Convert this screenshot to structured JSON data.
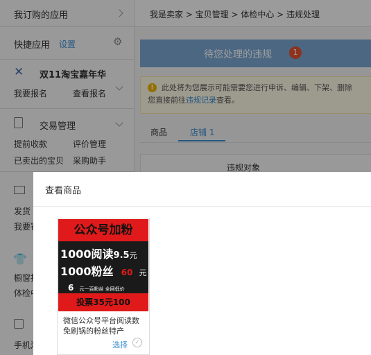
{
  "sidebar": {
    "subscribed_apps": "我订购的应用",
    "quick_apps": "快捷应用",
    "quick_settings": "设置",
    "promo_title": "双11淘宝嘉年华",
    "promo_links": [
      "我要报名",
      "查看报名"
    ],
    "trade_title": "交易管理",
    "trade_links": [
      "提前收款",
      "评价管理",
      "已卖出的宝贝",
      "采购助手"
    ],
    "partial_a": [
      "发货",
      "我要寄"
    ],
    "partial_b": [
      "橱窗推",
      "体检中"
    ],
    "partial_c": "手机淘"
  },
  "breadcrumb": "我是卖家 > 宝贝管理 > 体检中心 > 违规处理",
  "banner": {
    "label": "待您处理的违规",
    "count": "1"
  },
  "tip": {
    "line1": "此处将为您展示可能需要您进行申诉、编辑、下架、删除",
    "line2_prefix": "您直接前往",
    "line2_link": "违规记录",
    "line2_suffix": "查看。"
  },
  "tabs": [
    {
      "label": "商品"
    },
    {
      "label": "店铺 1"
    }
  ],
  "table": {
    "column": "违规对象"
  },
  "modal": {
    "title": "查看商品",
    "product": {
      "ad": {
        "headline": "公众号加粉",
        "line1_main": "1000阅读",
        "line1_price": "9.5",
        "line1_unit": "元",
        "line2_main": "1000粉丝",
        "line2_price": "60",
        "line2_unit": "元",
        "line3_num": "6",
        "line3_text": "元一百粉丝 全网低价",
        "bottom": "投票35元100"
      },
      "title": "微信公众号平台阅读数免刷锅的粉丝特产",
      "select_label": "选择"
    }
  },
  "colors": {
    "accent_blue": "#3d8fd1",
    "banner_blue": "#7aa6d2",
    "badge_red": "#e5512f",
    "ad_red": "#e01a1a",
    "ad_dark": "#1a1a1a"
  }
}
